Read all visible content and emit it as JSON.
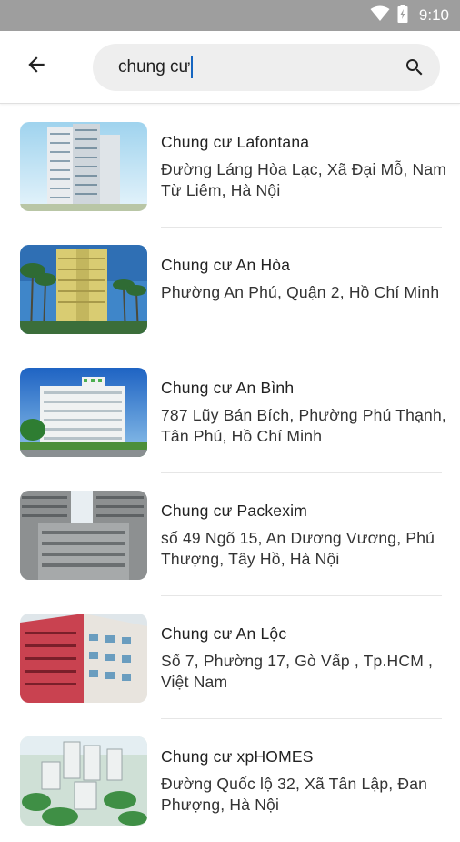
{
  "status_bar": {
    "time": "9:10"
  },
  "search": {
    "query": "chung cư"
  },
  "results": [
    {
      "name": "Chung cư Lafontana",
      "address": "Đường Láng Hòa Lạc, Xã Đại Mỗ, Nam Từ Liêm, Hà Nội"
    },
    {
      "name": "Chung cư An Hòa",
      "address": "Phường An Phú, Quận 2, Hồ Chí Minh"
    },
    {
      "name": "Chung cư An Bình",
      "address": "787 Lũy Bán Bích, Phường Phú Thạnh, Tân Phú, Hồ Chí Minh"
    },
    {
      "name": "Chung cư Packexim",
      "address": "số 49 Ngõ 15, An Dương Vương, Phú Thượng, Tây Hồ, Hà Nội"
    },
    {
      "name": "Chung cư An Lộc",
      "address": "Số 7, Phường 17, Gò Vấp , Tp.HCM , Việt Nam"
    },
    {
      "name": "Chung cư xpHOMES",
      "address": "Đường Quốc lộ 32, Xã Tân Lập, Đan Phượng, Hà Nội"
    }
  ]
}
